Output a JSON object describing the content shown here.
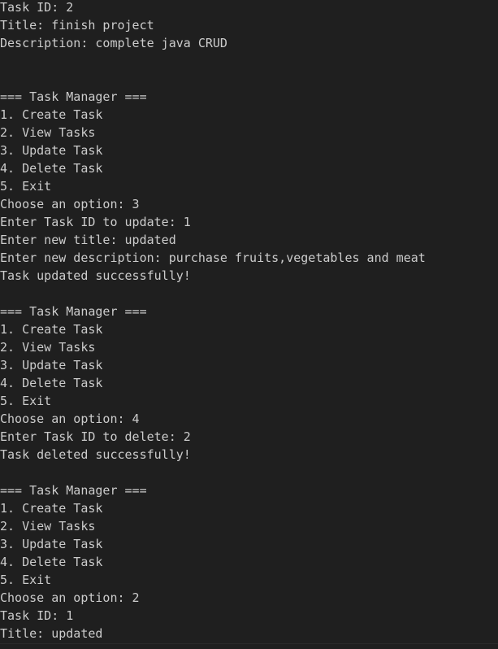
{
  "terminal": {
    "background_color": "#1f1f1f",
    "text_color": "#cccccc",
    "lines": [
      "Task ID: 2",
      "Title: finish project",
      "Description: complete java CRUD",
      "",
      "",
      "=== Task Manager ===",
      "1. Create Task",
      "2. View Tasks",
      "3. Update Task",
      "4. Delete Task",
      "5. Exit",
      "Choose an option: 3",
      "Enter Task ID to update: 1",
      "Enter new title: updated",
      "Enter new description: purchase fruits,vegetables and meat",
      "Task updated successfully!",
      "",
      "=== Task Manager ===",
      "1. Create Task",
      "2. View Tasks",
      "3. Update Task",
      "4. Delete Task",
      "5. Exit",
      "Choose an option: 4",
      "Enter Task ID to delete: 2",
      "Task deleted successfully!",
      "",
      "=== Task Manager ===",
      "1. Create Task",
      "2. View Tasks",
      "3. Update Task",
      "4. Delete Task",
      "5. Exit",
      "Choose an option: 2",
      "Task ID: 1",
      "Title: updated"
    ]
  }
}
